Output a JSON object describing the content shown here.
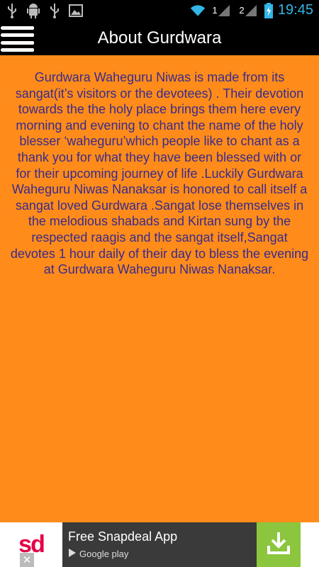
{
  "status_bar": {
    "time": "19:45",
    "signal_1": "1",
    "signal_2": "2",
    "icons": [
      "usb-icon",
      "android-icon",
      "usb-icon",
      "image-icon",
      "wifi-icon",
      "signal-icon",
      "signal-icon",
      "battery-charging-icon"
    ],
    "colors": {
      "time": "#33B5E5",
      "battery": "#33B5E5"
    }
  },
  "header": {
    "title": "About Gurdwara",
    "menu_icon": "menu-icon"
  },
  "main": {
    "body": "Gurdwara Waheguru Niwas is made from its sangat(it’s visitors or the devotees) . Their devotion towards the the holy place brings them here every morning and evening to chant the name of the holy blesser ‘waheguru’which people like to chant as a thank you for what they have been blessed with or for their upcoming journey of life .Luckily Gurdwara Waheguru Niwas Nanaksar is honored to call itself a sangat loved Gurdwara .Sangat lose themselves in the melodious shabads and Kirtan sung by the respected raagis and the sangat itself,Sangat devotes 1 hour daily of their day to bless the evening at Gurdwara Waheguru Niwas Nanaksar."
  },
  "ad": {
    "logo_text": "sd",
    "title": "Free Snapdeal App",
    "store": "Google play",
    "close": "✕",
    "colors": {
      "logo": "#E40046",
      "download_bg": "#8BC63E",
      "banner_bg": "#3A3A3A"
    }
  },
  "theme": {
    "background": "#FF8C1A",
    "text": "#3A2A8C"
  }
}
